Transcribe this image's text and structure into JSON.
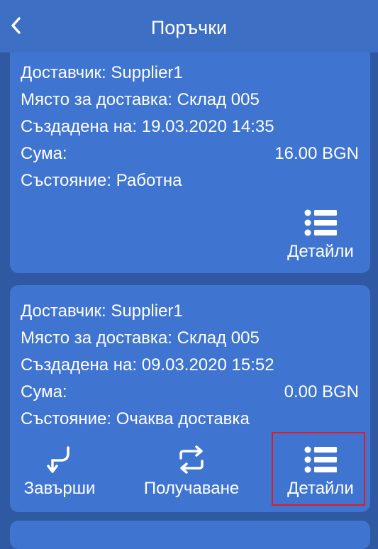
{
  "header": {
    "title": "Поръчки",
    "back_icon": "chevron-left-icon"
  },
  "orders": [
    {
      "supplier": "Доставчик: Supplier1",
      "location": "Място за доставка: Склад 005",
      "created": "Създадена на: 19.03.2020 14:35",
      "sum_label": "Сума:",
      "sum_value": "16.00 BGN",
      "status": "Състояние: Работна",
      "actions": {
        "details": "Детайли"
      }
    },
    {
      "supplier": "Доставчик: Supplier1",
      "location": "Място за доставка: Склад 005",
      "created": "Създадена на: 09.03.2020 15:52",
      "sum_label": "Сума:",
      "sum_value": "0.00 BGN",
      "status": "Състояние: Очаква доставка",
      "actions": {
        "finish": "Завърши",
        "receive": "Получаване",
        "details": "Детайли"
      }
    }
  ],
  "colors": {
    "background": "#2f5aa3",
    "appbar": "#3d6fc4",
    "card": "#3f74d1",
    "highlight": "#e8191e"
  }
}
